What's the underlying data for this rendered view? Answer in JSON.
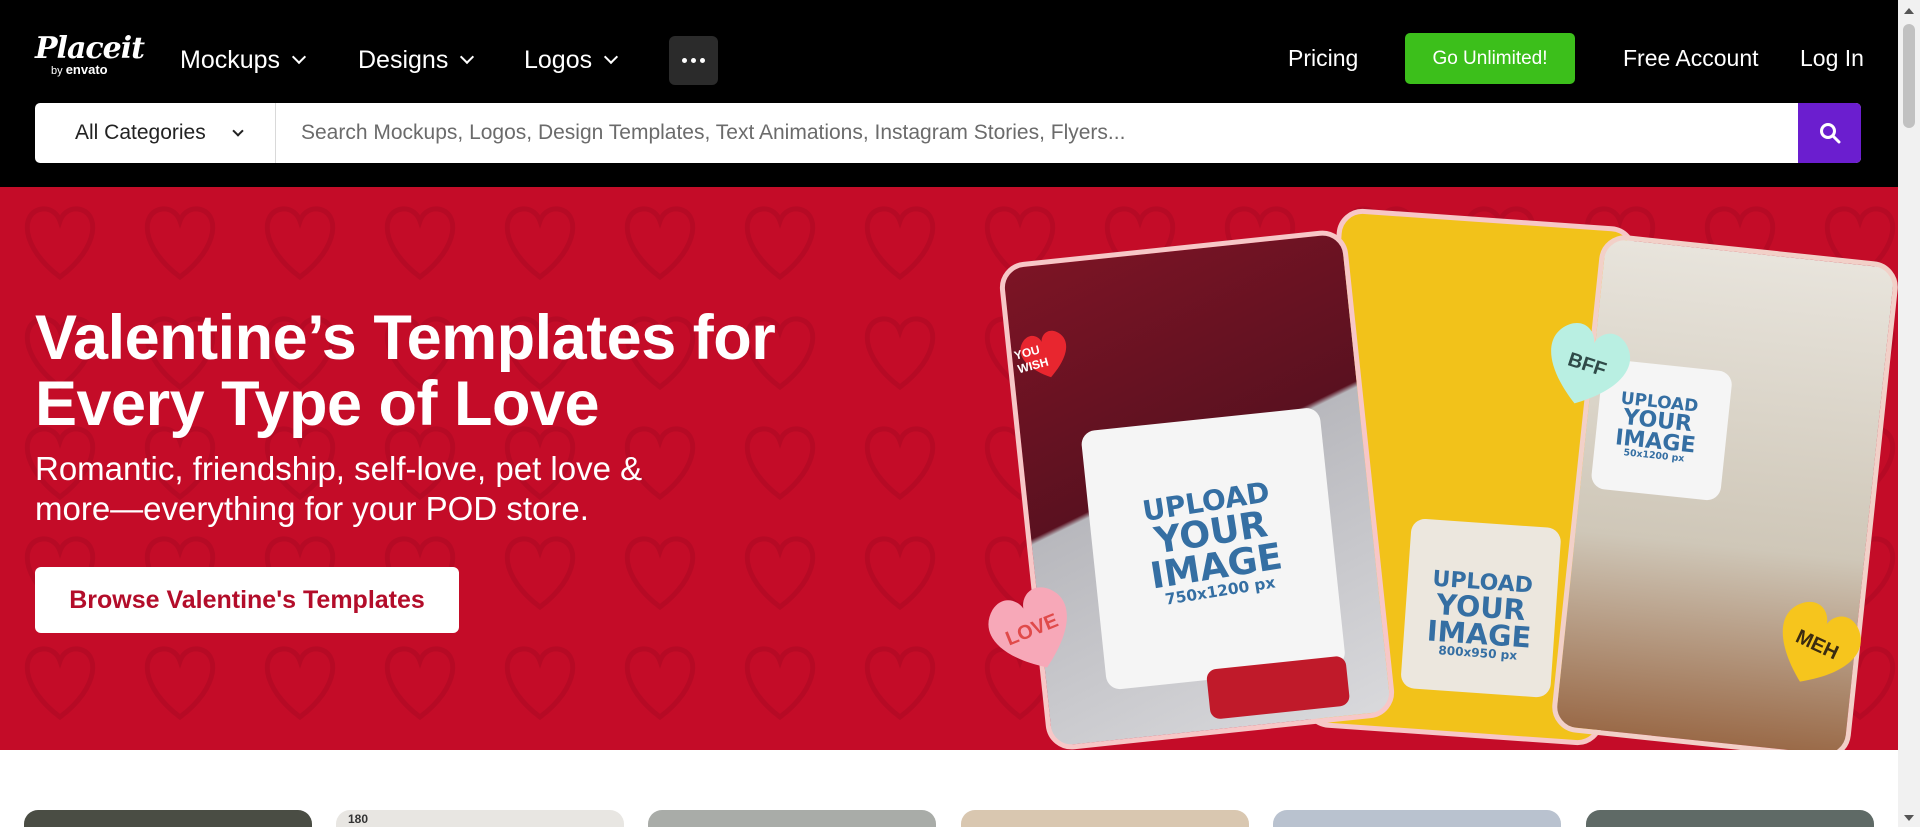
{
  "brand": {
    "name": "Placeit",
    "by": "by",
    "partner": "envato"
  },
  "nav": {
    "items": [
      {
        "label": "Mockups"
      },
      {
        "label": "Designs"
      },
      {
        "label": "Logos"
      }
    ],
    "more_icon": "more-horizontal-icon",
    "pricing": "Pricing",
    "go_unlimited": "Go Unlimited!",
    "free_account": "Free Account",
    "login": "Log In"
  },
  "search": {
    "category": "All Categories",
    "placeholder": "Search Mockups, Logos, Design Templates, Text Animations, Instagram Stories, Flyers...",
    "button_icon": "search-icon"
  },
  "hero": {
    "title": "Valentine’s Templates for Every Type of Love",
    "subtitle": "Romantic, friendship, self-love, pet love & more—everything for your POD store.",
    "cta": "Browse Valentine's Templates",
    "cards": [
      {
        "upload": "UPLOAD",
        "your": "YOUR",
        "image": "IMAGE",
        "size": "750x1200 px"
      },
      {
        "upload": "UPLOAD",
        "your": "YOUR",
        "image": "IMAGE",
        "size": "800x950 px"
      },
      {
        "upload": "UPLOAD",
        "your": "YOUR",
        "image": "IMAGE",
        "size": "50x1200 px"
      }
    ],
    "hearts": {
      "love": "LOVE",
      "wish": "YOU WISH",
      "bff": "BFF",
      "meh": "MEH"
    }
  },
  "thumbs": {
    "badge": "180"
  },
  "colors": {
    "header_bg": "#000000",
    "hero_bg": "#c40c28",
    "accent_green": "#3cbf1b",
    "search_purple": "#6b1ecf",
    "cta_text": "#b30d2a"
  }
}
